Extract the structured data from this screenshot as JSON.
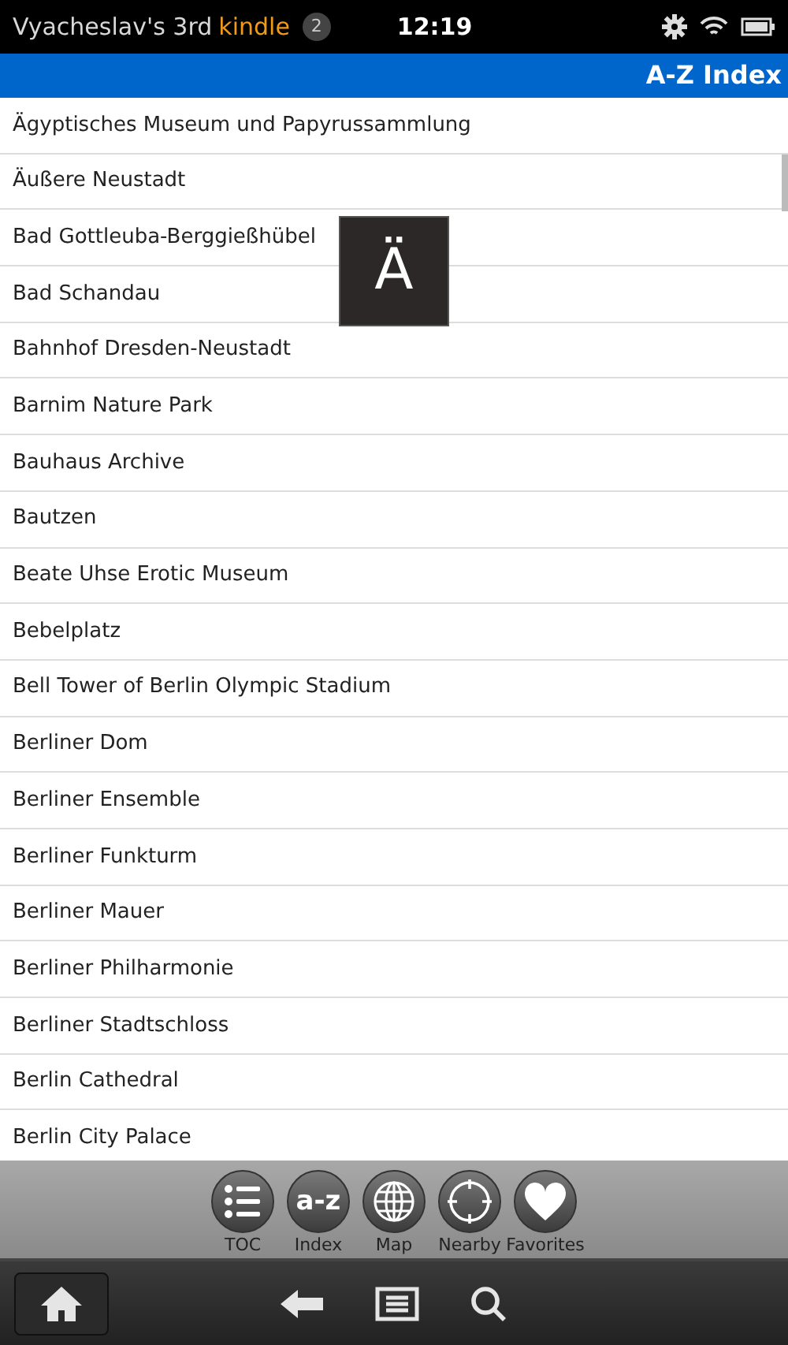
{
  "status_bar": {
    "device_name": "Vyacheslav's 3rd",
    "brand": "kindle",
    "notifications": "2",
    "time": "12:19"
  },
  "title_bar": {
    "title": "A-Z Index"
  },
  "index_popup": {
    "letter": "Ä"
  },
  "entries": [
    "Ägyptisches Museum und Papyrussammlung",
    "Äußere Neustadt",
    "Bad Gottleuba-Berggießhübel",
    "Bad Schandau",
    "Bahnhof Dresden-Neustadt",
    "Barnim Nature Park",
    "Bauhaus Archive",
    "Bautzen",
    "Beate Uhse Erotic Museum",
    "Bebelplatz",
    "Bell Tower of Berlin Olympic Stadium",
    "Berliner Dom",
    "Berliner Ensemble",
    "Berliner Funkturm",
    "Berliner Mauer",
    "Berliner Philharmonie",
    "Berliner Stadtschloss",
    "Berlin Cathedral",
    "Berlin City Palace"
  ],
  "toolbar": [
    {
      "kind": "toc",
      "label": "TOC"
    },
    {
      "kind": "index",
      "label": "Index",
      "icon_text": "a-z"
    },
    {
      "kind": "map",
      "label": "Map"
    },
    {
      "kind": "nearby",
      "label": "Nearby"
    },
    {
      "kind": "favorites",
      "label": "Favorites"
    }
  ],
  "nav_bar": [
    {
      "kind": "home"
    },
    {
      "kind": "back"
    },
    {
      "kind": "menu"
    },
    {
      "kind": "search"
    }
  ]
}
